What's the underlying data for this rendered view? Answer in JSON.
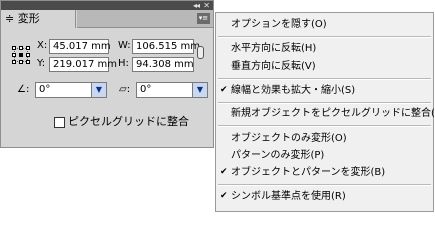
{
  "panel": {
    "collapse_glyph": "◂◂",
    "close_glyph": "✕",
    "tab_label": "≑ 変形",
    "menu_glyph": "▾≡",
    "fields": {
      "x_label": "X:",
      "x_value": "45.017 mm",
      "y_label": "Y:",
      "y_value": "219.017 mm",
      "w_label": "W:",
      "w_value": "106.515 mm",
      "h_label": "H:",
      "h_value": "94.308 mm"
    },
    "rotate": {
      "icon": "∠:",
      "value": "0°",
      "arrow": "▼"
    },
    "shear": {
      "icon": "▱:",
      "value": "0°",
      "arrow": "▼"
    },
    "pixel_grid_checkbox": {
      "label": "ピクセルグリッドに整合",
      "checked": false
    }
  },
  "menu": {
    "items": [
      {
        "label": "オプションを隠す(O)",
        "check": ""
      },
      {
        "label": "水平方向に反転(H)",
        "check": ""
      },
      {
        "label": "垂直方向に反転(V)",
        "check": ""
      },
      {
        "label": "線幅と効果も拡大・縮小(S)",
        "check": "✔"
      },
      {
        "label": "新規オブジェクトをピクセルグリッドに整合(A)",
        "check": ""
      },
      {
        "label": "オブジェクトのみ変形(O)",
        "check": ""
      },
      {
        "label": "パターンのみ変形(P)",
        "check": ""
      },
      {
        "label": "オブジェクトとパターンを変形(B)",
        "check": "✔"
      },
      {
        "label": "シンボル基準点を使用(R)",
        "check": "✔"
      }
    ]
  }
}
